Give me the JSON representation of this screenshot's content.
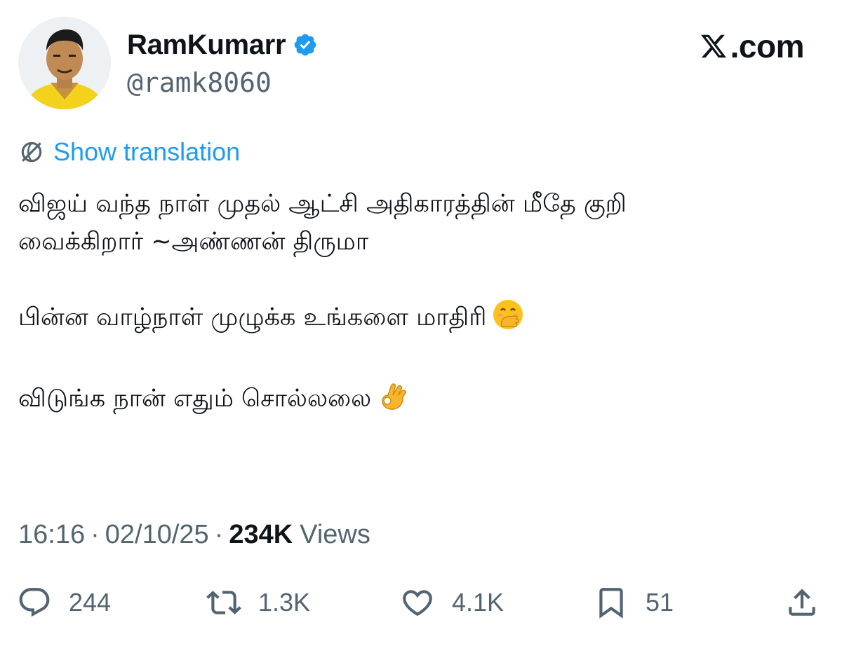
{
  "author": {
    "display_name": "RamKumarr",
    "handle": "@ramk8060",
    "verified": true,
    "avatar_icon": "profile-photo"
  },
  "brand": {
    "logo_icon": "x-logo",
    "text": ".com"
  },
  "translation": {
    "icon": "globe-icon",
    "label": "Show translation"
  },
  "tweet": {
    "line1": "விஜய் வந்த நாள் முதல் ஆட்சி அதிகாரத்தின் மீதே குறி",
    "line2": "வைக்கிறார் ~அண்ணன் திருமா",
    "line3": "பின்ன வாழ்நாள் முழுக்க உங்களை மாதிரி",
    "line3_emoji": "face-with-hand-over-mouth",
    "line4": "விடுங்க நான் எதும் சொல்லலை",
    "line4_emoji": "ok-hand"
  },
  "meta": {
    "time": "16:16",
    "separator": "·",
    "date": "02/10/25",
    "views_count": "234K",
    "views_label": "Views"
  },
  "actions": {
    "replies": "244",
    "reposts": "1.3K",
    "likes": "4.1K",
    "bookmarks": "51"
  },
  "colors": {
    "link": "#1d9bf0",
    "secondary_text": "#536471",
    "primary_text": "#0f1419",
    "verified_badge": "#1d9bf0"
  }
}
